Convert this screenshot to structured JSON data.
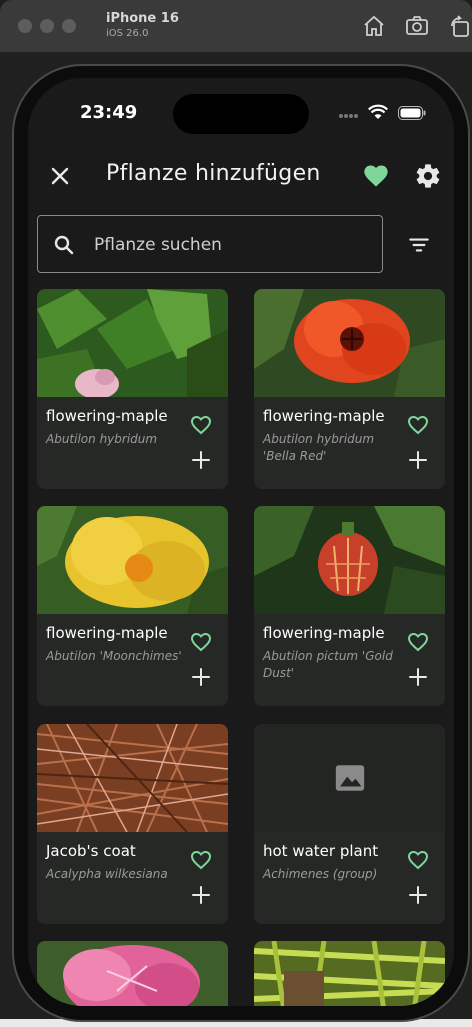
{
  "simulator": {
    "device": "iPhone 16",
    "os": "iOS 26.0",
    "icons": [
      "home-icon",
      "screenshot-icon",
      "rotate-icon"
    ]
  },
  "status_bar": {
    "time": "23:49"
  },
  "header": {
    "title": "Pflanze hinzufügen",
    "icons": [
      "close-icon",
      "heart-icon",
      "gear-icon"
    ]
  },
  "search": {
    "placeholder": "Pflanze suchen",
    "value": ""
  },
  "filter": {
    "icon": "filter-icon"
  },
  "plants": [
    {
      "name": "flowering-maple",
      "scientific": "Abutilon hybridum",
      "image": "green-leaves"
    },
    {
      "name": "flowering-maple",
      "scientific": "Abutilon hybridum 'Bella Red'",
      "image": "red-flower"
    },
    {
      "name": "flowering-maple",
      "scientific": "Abutilon 'Moonchimes'",
      "image": "yellow-flower"
    },
    {
      "name": "flowering-maple",
      "scientific": "Abutilon pictum 'Gold Dust'",
      "image": "striped-bell"
    },
    {
      "name": "Jacob's coat",
      "scientific": "Acalypha wilkesiana",
      "image": "brown-foliage"
    },
    {
      "name": "hot water plant",
      "scientific": "Achimenes (group)",
      "image": "image-placeholder-icon"
    }
  ],
  "colors": {
    "accent": "#7fd69a",
    "background": "#191a19",
    "card": "#262826"
  }
}
